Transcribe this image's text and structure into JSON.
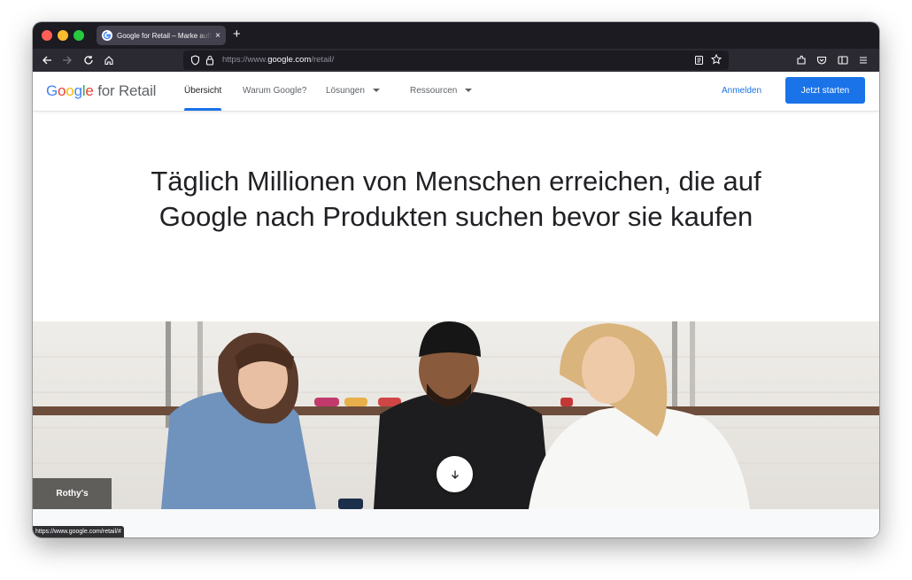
{
  "browser": {
    "tab": {
      "title": "Google for Retail – Marke aufbauen",
      "close_glyph": "×"
    },
    "new_tab_glyph": "+",
    "url": {
      "scheme": "https://www.",
      "host": "google.com",
      "path": "/retail/"
    },
    "status_url": "https://www.google.com/retail/#"
  },
  "site": {
    "logo": {
      "google": [
        "G",
        "o",
        "o",
        "g",
        "l",
        "e"
      ],
      "suffix": " for Retail"
    },
    "nav": [
      {
        "label": "Übersicht",
        "active": true
      },
      {
        "label": "Warum Google?"
      },
      {
        "label": "Lösungen",
        "dropdown": true
      },
      {
        "label": "Ressourcen",
        "dropdown": true
      }
    ],
    "signin_label": "Anmelden",
    "cta_label": "Jetzt starten"
  },
  "hero": {
    "title": "Täglich Millionen von Menschen erreichen, die auf Google nach Produkten suchen bevor sie kaufen",
    "photo_caption": "Rothy's",
    "scroll_icon": "arrow-down-icon"
  },
  "colors": {
    "accent": "#1a73e8",
    "google_blue": "#4285f4",
    "google_red": "#ea4335",
    "google_yellow": "#fbbc05",
    "google_green": "#34a853",
    "browser_chrome": "#1c1b22"
  }
}
